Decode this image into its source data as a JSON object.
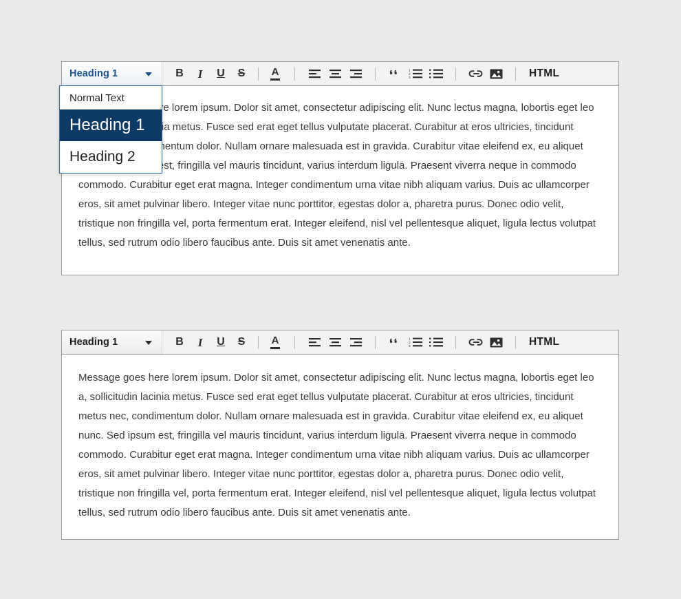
{
  "page": {
    "background_color": "#eaeaea",
    "accent_color": "#0d3b66",
    "link_color": "#1a5490"
  },
  "toolbar": {
    "format_select": {
      "value": "Heading 1",
      "caret_icon": "chevron-down-icon"
    },
    "buttons": [
      {
        "name": "bold-button",
        "label": "B",
        "icon": "bold-icon"
      },
      {
        "name": "italic-button",
        "label": "I",
        "icon": "italic-icon"
      },
      {
        "name": "underline-button",
        "label": "U",
        "icon": "underline-icon"
      },
      {
        "name": "strikethrough-button",
        "label": "S",
        "icon": "strikethrough-icon"
      },
      {
        "name": "text-color-button",
        "label": "A",
        "icon": "text-color-icon"
      },
      {
        "name": "align-left-button",
        "label": "",
        "icon": "align-left-icon"
      },
      {
        "name": "align-center-button",
        "label": "",
        "icon": "align-center-icon"
      },
      {
        "name": "align-right-button",
        "label": "",
        "icon": "align-right-icon"
      },
      {
        "name": "blockquote-button",
        "label": "",
        "icon": "blockquote-icon"
      },
      {
        "name": "ordered-list-button",
        "label": "",
        "icon": "numbered-list-icon"
      },
      {
        "name": "unordered-list-button",
        "label": "",
        "icon": "bulleted-list-icon"
      },
      {
        "name": "link-button",
        "label": "",
        "icon": "link-icon"
      },
      {
        "name": "image-button",
        "label": "",
        "icon": "image-icon"
      }
    ],
    "html_button_label": "HTML"
  },
  "format_menu": {
    "open": true,
    "items": [
      {
        "label": "Normal Text",
        "selected": false
      },
      {
        "label": "Heading 1",
        "selected": true
      },
      {
        "label": "Heading 2",
        "selected": false
      }
    ]
  },
  "editors": {
    "first": {
      "format_value": "Heading 1",
      "body_text": "Message goes here lorem ipsum. Dolor sit amet, consectetur adipiscing elit. Nunc lectus magna, lobortis eget leo a, sollicitudin lacinia metus. Fusce sed erat eget tellus vulputate placerat. Curabitur at eros ultricies, tincidunt metus nec, condimentum dolor. Nullam ornare malesuada est in gravida. Curabitur vitae eleifend ex, eu aliquet nunc. Sed ipsum est, fringilla vel mauris tincidunt, varius interdum ligula. Praesent viverra neque in commodo commodo. Curabitur eget erat magna. Integer condimentum urna vitae nibh aliquam varius. Duis ac ullamcorper eros, sit amet pulvinar libero. Integer vitae nunc porttitor, egestas dolor a, pharetra purus. Donec odio velit, tristique non fringilla vel, porta fermentum erat. Integer eleifend, nisl vel pellentesque aliquet, ligula lectus volutpat tellus, sed rutrum odio libero faucibus ante. Duis sit amet venenatis ante."
    },
    "second": {
      "format_value": "Heading 1",
      "body_text": "Message goes here lorem ipsum. Dolor sit amet, consectetur adipiscing elit. Nunc lectus magna, lobortis eget leo a, sollicitudin lacinia metus. Fusce sed erat eget tellus vulputate placerat. Curabitur at eros ultricies, tincidunt metus nec, condimentum dolor. Nullam ornare malesuada est in gravida. Curabitur vitae eleifend ex, eu aliquet nunc. Sed ipsum est, fringilla vel mauris tincidunt, varius interdum ligula. Praesent viverra neque in commodo commodo. Curabitur eget erat magna. Integer condimentum urna vitae nibh aliquam varius. Duis ac ullamcorper eros, sit amet pulvinar libero. Integer vitae nunc porttitor, egestas dolor a, pharetra purus. Donec odio velit, tristique non fringilla vel, porta fermentum erat. Integer eleifend, nisl vel pellentesque aliquet, ligula lectus volutpat tellus, sed rutrum odio libero faucibus ante. Duis sit amet venenatis ante."
    }
  }
}
